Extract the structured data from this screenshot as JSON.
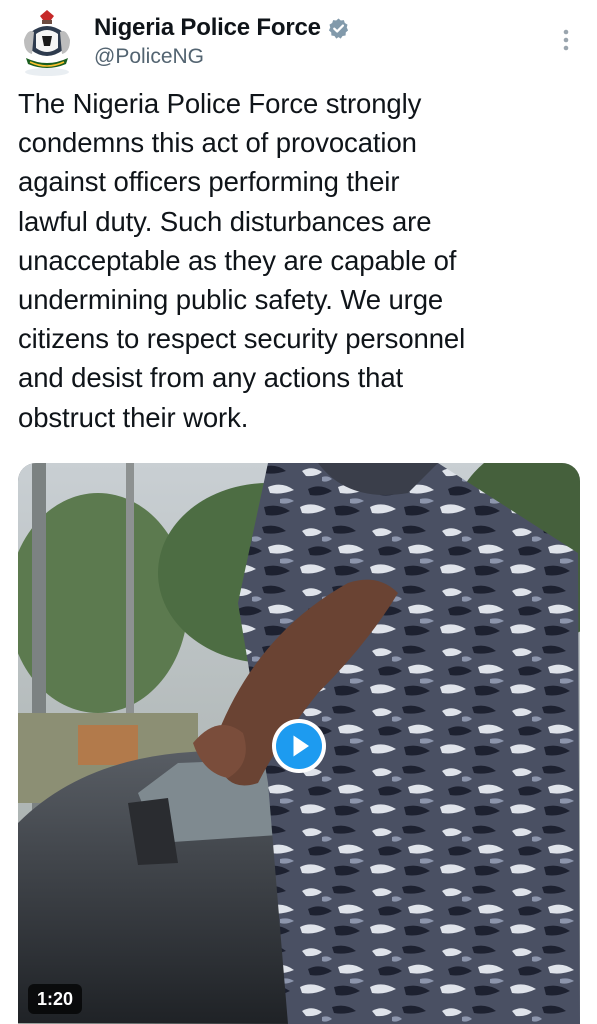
{
  "account": {
    "display_name": "Nigeria Police Force",
    "handle": "@PoliceNG",
    "verified": true,
    "verified_badge_color": "#829aab"
  },
  "tweet": {
    "text": "The Nigeria Police Force strongly\ncondemns this act of provocation\nagainst officers performing their\nlawful duty. Such disturbances are\nunacceptable as they are capable of\nundermining public safety. We urge\ncitizens to respect security personnel\nand desist from any actions that\nobstruct their work."
  },
  "media": {
    "type": "video",
    "duration": "1:20",
    "play_button_color": "#1d9bf0"
  },
  "icons": {
    "more": "more-vertical-icon",
    "play": "play-icon",
    "verified": "verified-badge-icon"
  }
}
